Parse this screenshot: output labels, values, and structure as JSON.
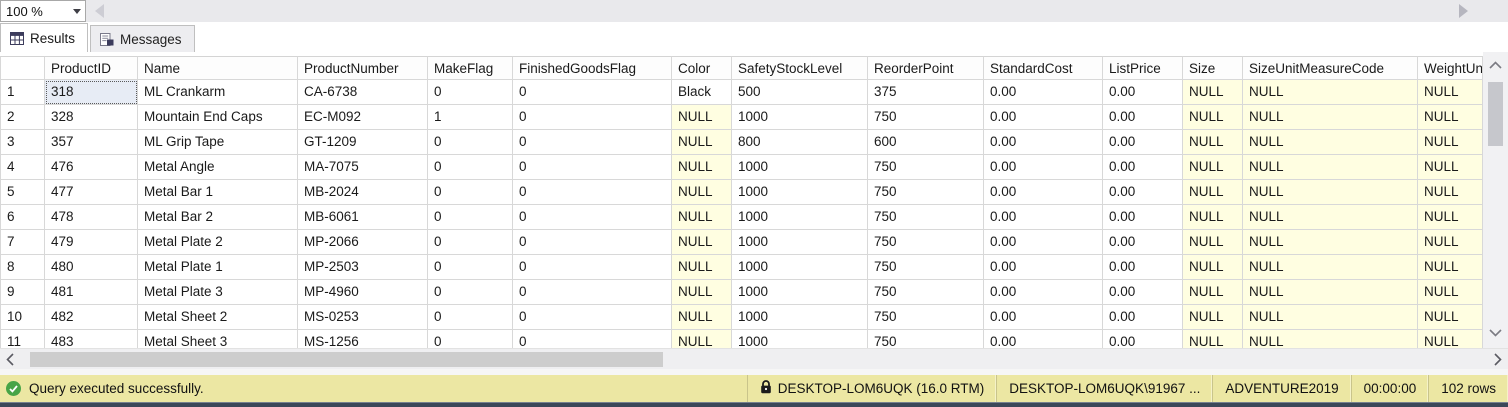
{
  "zoom_control": {
    "value": "100 %"
  },
  "tabs": [
    {
      "label": "Results",
      "active": true,
      "icon": "results-grid-icon"
    },
    {
      "label": "Messages",
      "active": false,
      "icon": "messages-icon"
    }
  ],
  "grid": {
    "columns": [
      "ProductID",
      "Name",
      "ProductNumber",
      "MakeFlag",
      "FinishedGoodsFlag",
      "Color",
      "SafetyStockLevel",
      "ReorderPoint",
      "StandardCost",
      "ListPrice",
      "Size",
      "SizeUnitMeasureCode",
      "WeightUnitMeasureCode"
    ],
    "selected_cell": {
      "row": 0,
      "col": 0
    },
    "rows": [
      {
        "num": "1",
        "cells": [
          "318",
          "ML Crankarm",
          "CA-6738",
          "0",
          "0",
          "Black",
          "500",
          "375",
          "0.00",
          "0.00",
          "NULL",
          "NULL",
          "NULL"
        ]
      },
      {
        "num": "2",
        "cells": [
          "328",
          "Mountain End Caps",
          "EC-M092",
          "1",
          "0",
          "NULL",
          "1000",
          "750",
          "0.00",
          "0.00",
          "NULL",
          "NULL",
          "NULL"
        ]
      },
      {
        "num": "3",
        "cells": [
          "357",
          "ML Grip Tape",
          "GT-1209",
          "0",
          "0",
          "NULL",
          "800",
          "600",
          "0.00",
          "0.00",
          "NULL",
          "NULL",
          "NULL"
        ]
      },
      {
        "num": "4",
        "cells": [
          "476",
          "Metal Angle",
          "MA-7075",
          "0",
          "0",
          "NULL",
          "1000",
          "750",
          "0.00",
          "0.00",
          "NULL",
          "NULL",
          "NULL"
        ]
      },
      {
        "num": "5",
        "cells": [
          "477",
          "Metal Bar 1",
          "MB-2024",
          "0",
          "0",
          "NULL",
          "1000",
          "750",
          "0.00",
          "0.00",
          "NULL",
          "NULL",
          "NULL"
        ]
      },
      {
        "num": "6",
        "cells": [
          "478",
          "Metal Bar 2",
          "MB-6061",
          "0",
          "0",
          "NULL",
          "1000",
          "750",
          "0.00",
          "0.00",
          "NULL",
          "NULL",
          "NULL"
        ]
      },
      {
        "num": "7",
        "cells": [
          "479",
          "Metal Plate 2",
          "MP-2066",
          "0",
          "0",
          "NULL",
          "1000",
          "750",
          "0.00",
          "0.00",
          "NULL",
          "NULL",
          "NULL"
        ]
      },
      {
        "num": "8",
        "cells": [
          "480",
          "Metal Plate 1",
          "MP-2503",
          "0",
          "0",
          "NULL",
          "1000",
          "750",
          "0.00",
          "0.00",
          "NULL",
          "NULL",
          "NULL"
        ]
      },
      {
        "num": "9",
        "cells": [
          "481",
          "Metal Plate 3",
          "MP-4960",
          "0",
          "0",
          "NULL",
          "1000",
          "750",
          "0.00",
          "0.00",
          "NULL",
          "NULL",
          "NULL"
        ]
      },
      {
        "num": "10",
        "cells": [
          "482",
          "Metal Sheet 2",
          "MS-0253",
          "0",
          "0",
          "NULL",
          "1000",
          "750",
          "0.00",
          "0.00",
          "NULL",
          "NULL",
          "NULL"
        ]
      },
      {
        "num": "11",
        "cells": [
          "483",
          "Metal Sheet 3",
          "MS-1256",
          "0",
          "0",
          "NULL",
          "1000",
          "750",
          "0.00",
          "0.00",
          "NULL",
          "NULL",
          "NULL"
        ]
      }
    ]
  },
  "status_bar": {
    "message": "Query executed successfully.",
    "server": "DESKTOP-LOM6UQK (16.0 RTM)",
    "user": "DESKTOP-LOM6UQK\\91967 ...",
    "database": "ADVENTURE2019",
    "duration": "00:00:00",
    "row_count": "102 rows"
  },
  "colors": {
    "null_cell_bg": "#fffee1",
    "status_bar_bg": "#ece7a3",
    "success_green": "#47a447",
    "selected_cell_bg": "#e7ecf5",
    "grid_line": "#d8d8d8",
    "bottom_edge": "#3b4759"
  }
}
